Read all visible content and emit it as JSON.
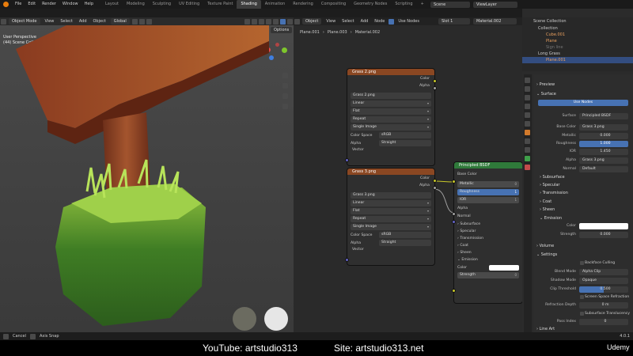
{
  "menus": [
    "File",
    "Edit",
    "Render",
    "Window",
    "Help"
  ],
  "workspaces": [
    "Layout",
    "Modeling",
    "Sculpting",
    "UV Editing",
    "Texture Paint",
    "Shading",
    "Animation",
    "Rendering",
    "Compositing",
    "Geometry Nodes",
    "Scripting"
  ],
  "active_workspace": "Shading",
  "scene": "Scene",
  "view_layer": "ViewLayer",
  "viewport": {
    "mode": "Object Mode",
    "menus": [
      "View",
      "Select",
      "Add",
      "Object"
    ],
    "orientation": "Global",
    "title": "User Perspective",
    "subtitle": "(44) Scene Collection | Plane.001",
    "options": "Options"
  },
  "node_editor": {
    "mode": "Object",
    "menus": [
      "View",
      "Select",
      "Add",
      "Node"
    ],
    "use_nodes": "Use Nodes",
    "slot": "Slot 1",
    "material": "Material.002",
    "breadcrumb": [
      "Plane.001",
      "Plane.003",
      "Material.002"
    ]
  },
  "nodes": [
    {
      "title": "Grass 2.png",
      "out_color": "Color",
      "out_alpha": "Alpha",
      "image": "Grass 2.png",
      "interp": "Linear",
      "proj": "Flat",
      "ext": "Repeat",
      "src": "Single Image",
      "cs_label": "Color Space",
      "cs": "sRGB",
      "alpha_label": "Alpha",
      "alpha": "Straight",
      "vector": "Vector"
    },
    {
      "title": "Grass 3.png",
      "out_color": "Color",
      "out_alpha": "Alpha",
      "image": "Grass 3.png",
      "interp": "Linear",
      "proj": "Flat",
      "ext": "Repeat",
      "src": "Single Image",
      "cs_label": "Color Space",
      "cs": "sRGB",
      "alpha_label": "Alpha",
      "alpha": "Straight",
      "vector": "Vector"
    }
  ],
  "bsdf": {
    "title": "Principled BSDF",
    "base": "Base Color",
    "metallic": "Metallic",
    "metallic_val": "0",
    "roughness": "Roughness",
    "roughness_val": "1",
    "ior": "IOR",
    "ior_val": "1",
    "alpha": "Alpha",
    "normal": "Normal",
    "subs": [
      "Subsurface",
      "Specular",
      "Transmission",
      "Coat",
      "Sheen",
      "Emission"
    ],
    "color": "Color",
    "strength": "Strength",
    "strength_val": "0"
  },
  "outliner": {
    "title": "Scene Collection",
    "items": [
      "Collection",
      "Cube.001",
      "Plane",
      "Sign line",
      "Long Grass",
      "Plane.001"
    ]
  },
  "props": {
    "preview": "Preview",
    "surface": "Surface",
    "use_nodes": "Use Nodes",
    "rows": [
      {
        "k": "Surface",
        "v": "Principled BSDF"
      },
      {
        "k": "Base Color",
        "v": "Grass 3.png"
      },
      {
        "k": "Metallic",
        "v": "0.000"
      },
      {
        "k": "Roughness",
        "v": "1.000"
      },
      {
        "k": "IOR",
        "v": "1.450"
      },
      {
        "k": "Alpha",
        "v": "Grass 3.png"
      },
      {
        "k": "Normal",
        "v": "Default"
      }
    ],
    "subs": [
      "Subsurface",
      "Specular",
      "Transmission",
      "Coat",
      "Sheen",
      "Emission"
    ],
    "em_color": "Color",
    "em_strength": "Strength",
    "em_strength_val": "0.000",
    "volume": "Volume",
    "settings": "Settings",
    "backface": "Backface Culling",
    "blend_k": "Blend Mode",
    "blend_v": "Alpha Clip",
    "shadow_k": "Shadow Mode",
    "shadow_v": "Opaque",
    "clip_k": "Clip Threshold",
    "clip_v": "0.500",
    "ssr": "Screen Space Refraction",
    "rd_k": "Refraction Depth",
    "rd_v": "0 m",
    "sst": "Subsurface Translucency",
    "pi_k": "Pass Index",
    "pi_v": "0",
    "lineart": "Line Art"
  },
  "status": {
    "left1": "Cancel",
    "left2": "Axis Snap",
    "right": "4.0.1"
  },
  "footer": {
    "youtube": "YouTube: artstudio313",
    "site": "Site: artstudio313.net",
    "brand": "Udemy"
  }
}
